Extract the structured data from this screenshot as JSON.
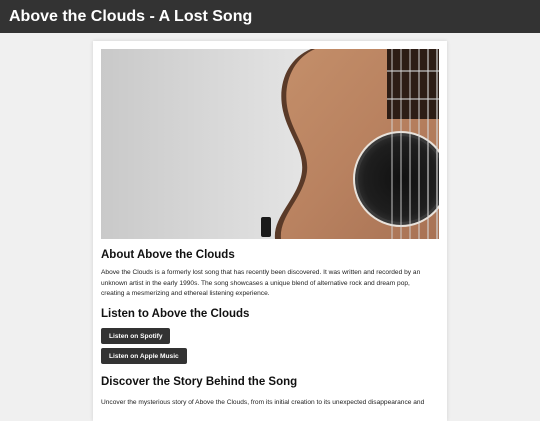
{
  "header": {
    "title": "Above the Clouds - A Lost Song"
  },
  "hero": {
    "image_icon": "acoustic-guitar-photo"
  },
  "about": {
    "heading": "About Above the Clouds",
    "line1": "Above the Clouds is a formerly lost song that has recently been discovered. It was written and recorded by an",
    "line2": "unknown artist in the early 1990s. The song showcases a unique blend of alternative rock and dream pop,",
    "line3": "creating a mesmerizing and ethereal listening experience."
  },
  "listen": {
    "heading": "Listen to Above the Clouds",
    "spotify_label": "Listen on Spotify",
    "apple_label": "Listen on Apple Music"
  },
  "story": {
    "heading": "Discover the Story Behind the Song",
    "line1": "Uncover the mysterious story of Above the Clouds, from its initial creation to its unexpected disappearance and"
  },
  "colors": {
    "topbar": "#333333",
    "button": "#333333",
    "page_background": "#f0f0f0",
    "card_background": "#ffffff"
  }
}
